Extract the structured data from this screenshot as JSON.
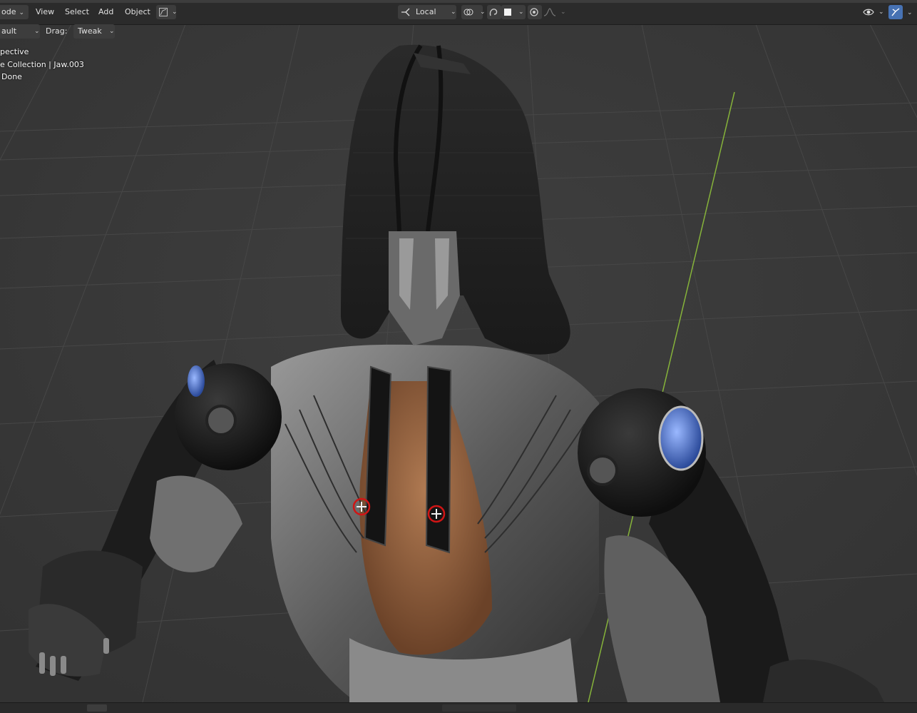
{
  "header": {
    "mode_label": "ode",
    "menus": [
      "View",
      "Select",
      "Add",
      "Object"
    ],
    "transform_orientation": "Local",
    "drag_label": "Drag:",
    "drag_value": "Tweak",
    "orientation_left": "ault"
  },
  "viewport": {
    "view_name": "pective",
    "collection_info": "e Collection | Jaw.003",
    "status_text": "Done"
  },
  "colors": {
    "header_bg": "#2b2b2b",
    "viewport_bg": "#393939",
    "grid_line": "#444444",
    "y_axis": "#86b33a",
    "active_button": "#4772b3"
  },
  "icons": [
    "snap-icon",
    "proportional-edit-icon",
    "overlay-icon",
    "gizmo-icon",
    "transform-orientation-icon",
    "pivot-icon"
  ]
}
